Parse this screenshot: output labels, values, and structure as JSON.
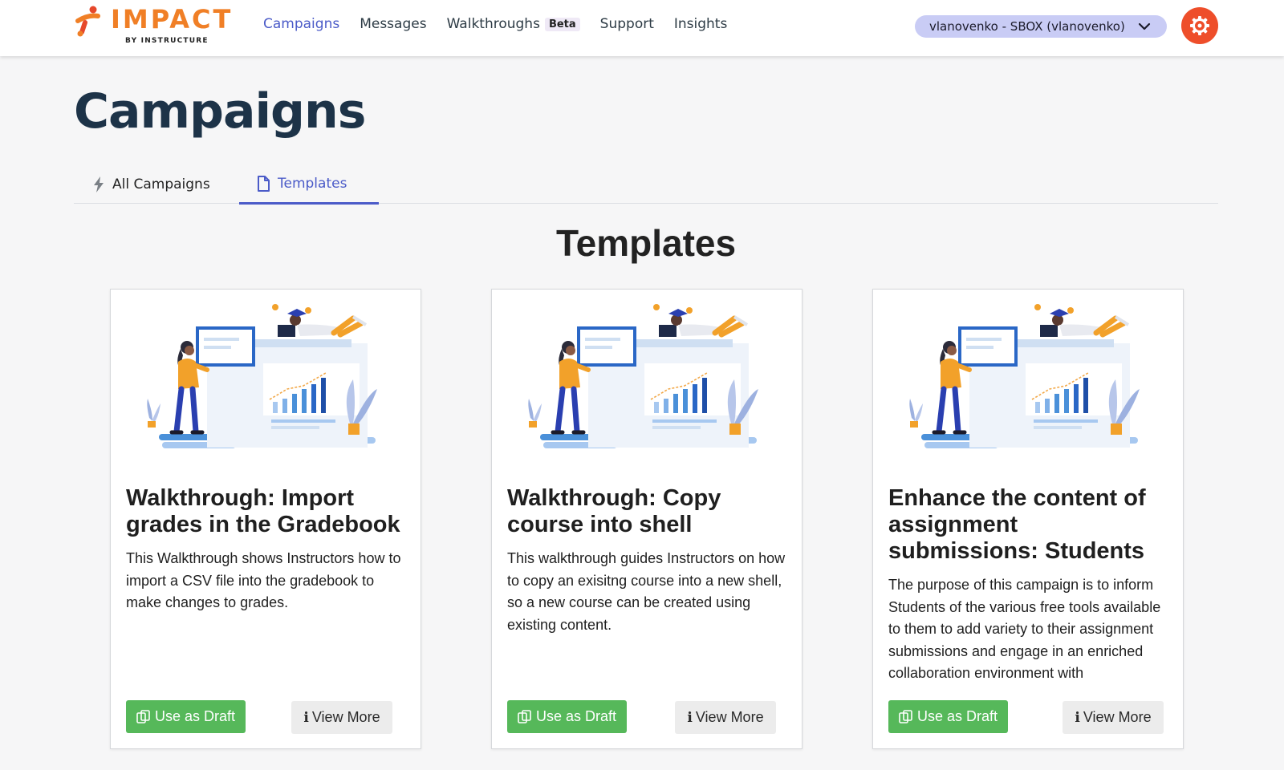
{
  "logo": {
    "name": "IMPACT",
    "sub_prefix": "BY",
    "sub_brand": "INSTRUCTURE"
  },
  "nav": {
    "items": [
      {
        "label": "Campaigns",
        "active": true
      },
      {
        "label": "Messages"
      },
      {
        "label": "Walkthroughs",
        "badge": "Beta"
      },
      {
        "label": "Support"
      },
      {
        "label": "Insights"
      }
    ]
  },
  "account": {
    "label": "vlanovenko - SBOX (vlanovenko)"
  },
  "icons": {
    "settings": "gear-icon",
    "dropdown": "chevron-down-icon",
    "all_campaigns": "bolt-icon",
    "templates": "document-icon",
    "draft": "copy-icon",
    "info": "info-icon"
  },
  "colors": {
    "accent": "#4b5bc8",
    "brand_orange": "#f07f26",
    "settings_red": "#ee4e2a",
    "draft_green": "#56b85a",
    "heading": "#1d3348"
  },
  "page": {
    "title": "Campaigns"
  },
  "tabs": [
    {
      "label": "All Campaigns"
    },
    {
      "label": "Templates",
      "active": true
    }
  ],
  "section": {
    "title": "Templates"
  },
  "cards": [
    {
      "title": "Walkthrough: Import grades in the Gradebook",
      "description": "This Walkthrough shows Instructors how to import a CSV file into the gradebook to make changes to grades.",
      "draft_label": "Use as Draft",
      "more_label": "View More"
    },
    {
      "title": "Walkthrough: Copy course into shell",
      "description": "This walkthrough guides Instructors on how to copy an exisitng course into a new shell, so a new course can be created using existing content.",
      "draft_label": "Use as Draft",
      "more_label": "View More"
    },
    {
      "title": "Enhance the content of assignment submissions: Students",
      "description": "The purpose of this campaign is to inform Students of the various free tools available to them to add variety to their assignment submissions and engage in an enriched collaboration environment with",
      "draft_label": "Use as Draft",
      "more_label": "View More"
    }
  ]
}
